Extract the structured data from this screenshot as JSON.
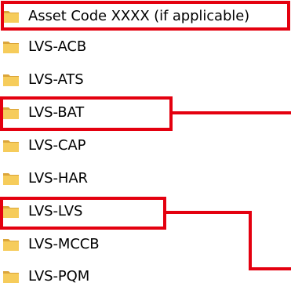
{
  "colors": {
    "highlight": "#e4000f",
    "folder_fill": "#f6cc5b",
    "folder_dark": "#dba53a",
    "text": "#000000"
  },
  "folders": [
    {
      "label": "Asset Code XXXX (if applicable)",
      "icon": "folder-icon"
    },
    {
      "label": "LVS-ACB",
      "icon": "folder-icon"
    },
    {
      "label": "LVS-ATS",
      "icon": "folder-icon"
    },
    {
      "label": "LVS-BAT",
      "icon": "folder-icon"
    },
    {
      "label": "LVS-CAP",
      "icon": "folder-icon"
    },
    {
      "label": "LVS-HAR",
      "icon": "folder-icon"
    },
    {
      "label": "LVS-LVS",
      "icon": "folder-icon"
    },
    {
      "label": "LVS-MCCB",
      "icon": "folder-icon"
    },
    {
      "label": "LVS-PQM",
      "icon": "folder-icon"
    }
  ],
  "highlighted_items": [
    "Asset Code XXXX (if applicable)",
    "LVS-BAT",
    "LVS-LVS"
  ]
}
